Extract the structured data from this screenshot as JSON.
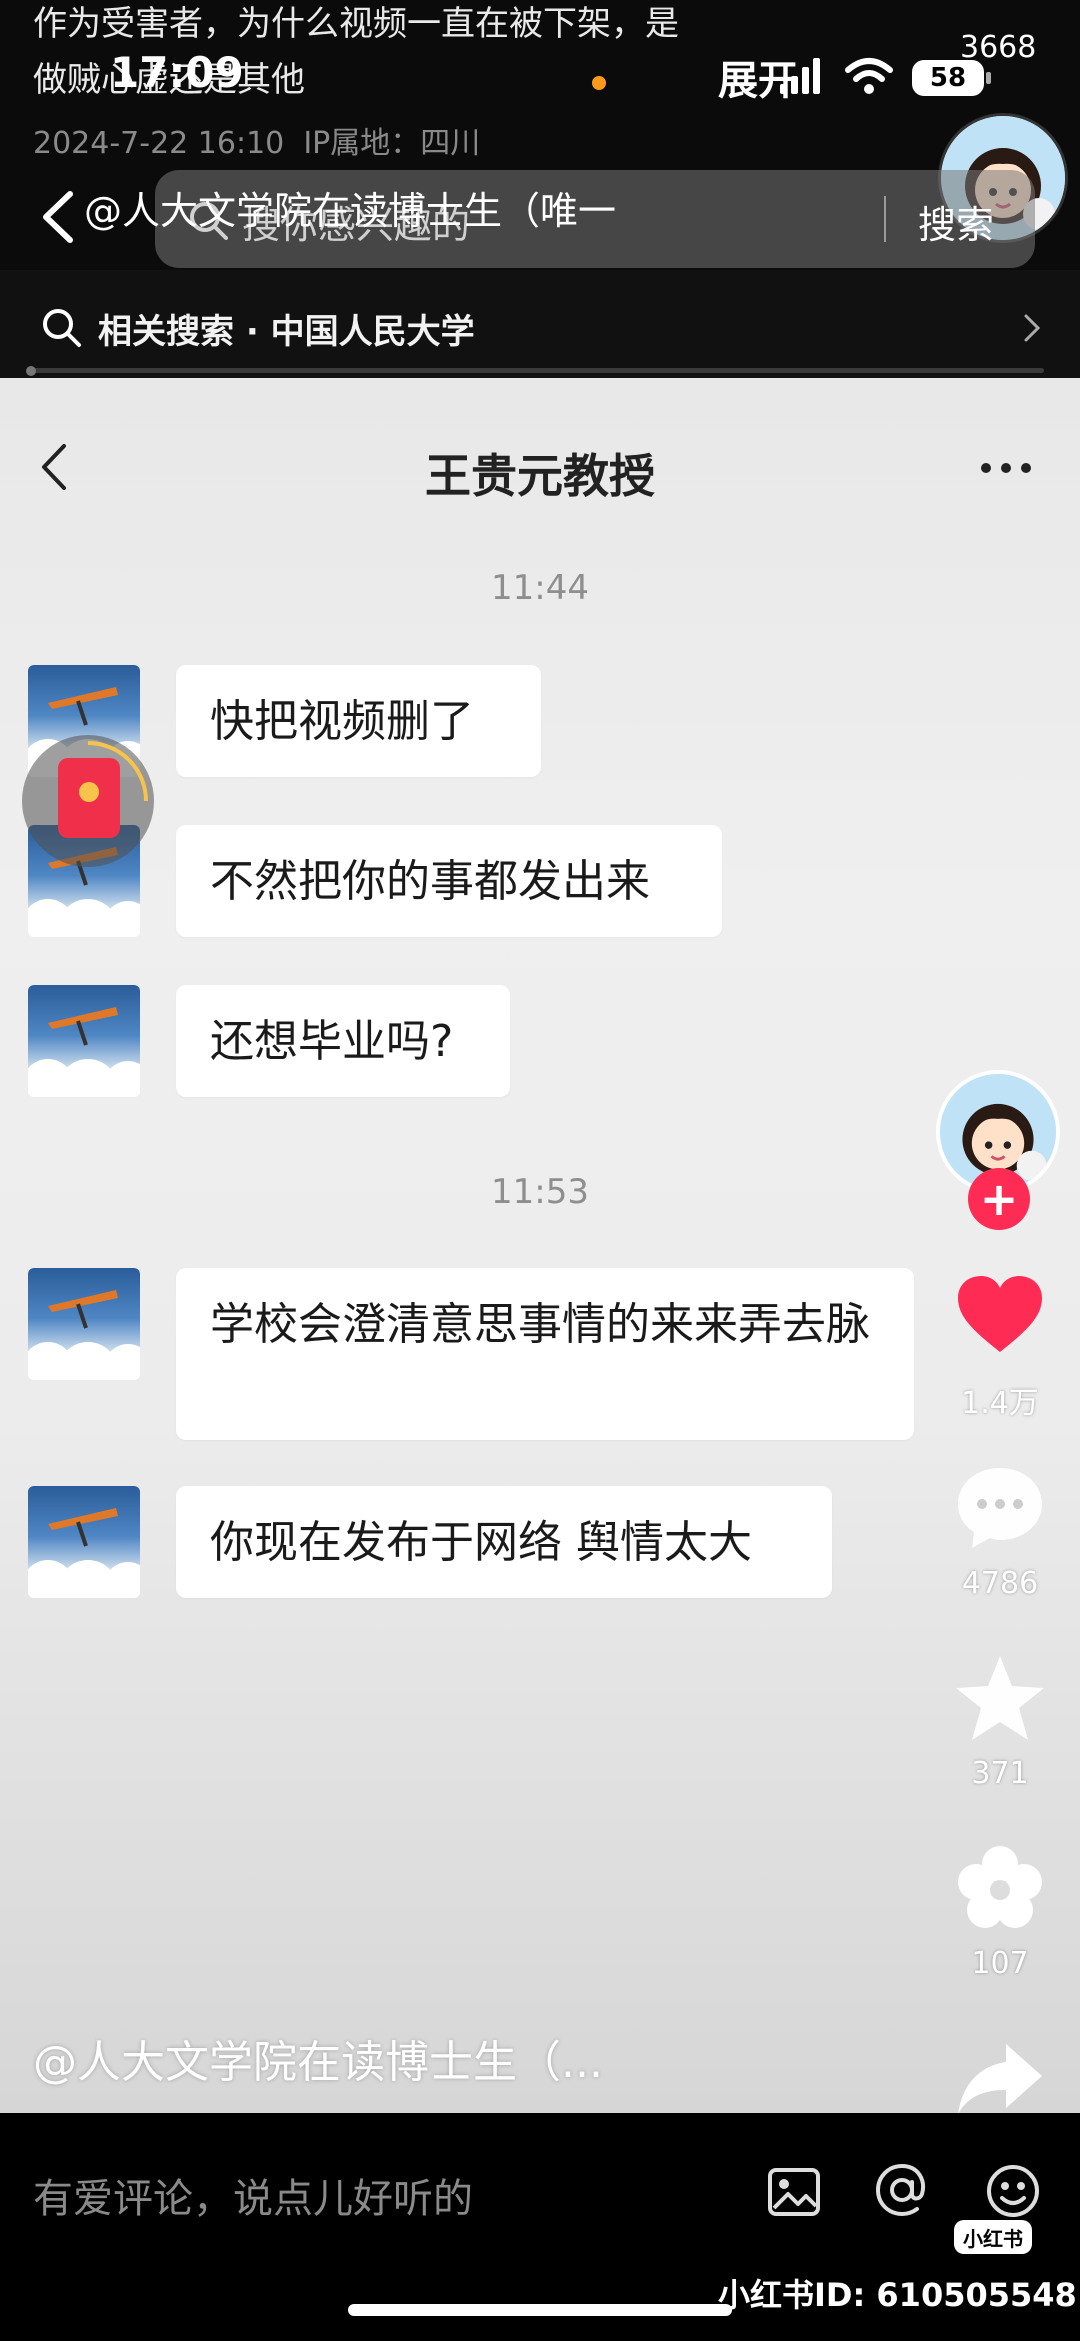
{
  "status_bar": {
    "time": "17:09",
    "expand_label": "展开",
    "battery": "58",
    "follower_count": "3668"
  },
  "post": {
    "desc_line1": "作为受害者，为什么视频一直在被下架，是",
    "desc_line2": "做贼心虚还是其他",
    "date": "2024-7-22 16:10",
    "ip_location": "IP属地：四川",
    "author_handle": "@人大文学院在读博士生（唯一",
    "bottom_handle": "@人大文学院在读博士生（..."
  },
  "search": {
    "placeholder": "搜你感兴趣的",
    "button": "搜索"
  },
  "related_search": {
    "text": "相关搜索 · 中国人民大学"
  },
  "chat": {
    "title": "王贵元教授",
    "groups": [
      {
        "time": "11:44",
        "messages": [
          "快把视频删了",
          "不然把你的事都发出来",
          "还想毕业吗?"
        ]
      },
      {
        "time": "11:53",
        "messages": [
          "学校会澄清意思事情的来来弄去脉",
          "你现在发布于网络 舆情太大"
        ]
      }
    ]
  },
  "rail": {
    "likes": "1.4万",
    "comments": "4786",
    "favorites": "371",
    "shares": "107"
  },
  "comment_bar": {
    "placeholder": "有爱评论，说点儿好听的",
    "logo": "小红书"
  },
  "watermark": "小红书ID: 610505548",
  "colors": {
    "like_red": "#fe2c55",
    "follow_red": "#fe2c55",
    "red_packet": "#f0304a"
  },
  "icons": [
    "signal-icon",
    "wifi-icon",
    "back-icon",
    "search-icon",
    "chevron-right-icon",
    "more-icon",
    "heart-icon",
    "comment-icon",
    "star-icon",
    "flower-icon",
    "share-icon",
    "image-icon",
    "at-icon",
    "emoji-icon"
  ]
}
